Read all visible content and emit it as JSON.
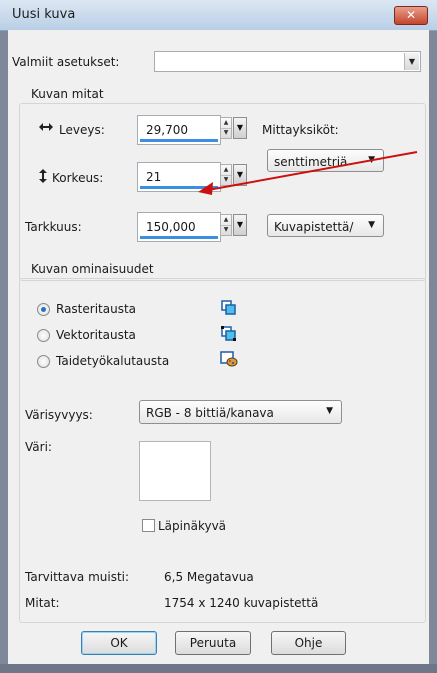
{
  "window": {
    "title": "Uusi kuva",
    "close_label": "✕"
  },
  "presets": {
    "label": "Valmiit asetukset:",
    "value": ""
  },
  "dimensions": {
    "group_label": "Kuvan mitat",
    "width_label": "Leveys:",
    "width_value": "29,700",
    "height_label": "Korkeus:",
    "height_value": "21",
    "resolution_label": "Tarkkuus:",
    "resolution_value": "150,000",
    "units_label": "Mittayksiköt:",
    "units_value": "senttimetriä",
    "resolution_unit_value": "Kuvapistettä/"
  },
  "properties": {
    "group_label": "Kuvan ominaisuudet",
    "options": [
      {
        "label": "Rasteritausta",
        "selected": true,
        "icon": "raster-layer-icon"
      },
      {
        "label": "Vektoritausta",
        "selected": false,
        "icon": "vector-layer-icon"
      },
      {
        "label": "Taidetyökalutausta",
        "selected": false,
        "icon": "art-media-layer-icon"
      }
    ],
    "depth_label": "Värisyvyys:",
    "depth_value": "RGB - 8 bittiä/kanava",
    "color_label": "Väri:",
    "transparent_label": "Läpinäkyvä",
    "transparent_checked": false,
    "memory_label": "Tarvittava muisti:",
    "memory_value": "6,5 Megatavua",
    "size_label": "Mitat:",
    "size_value": "1754 x 1240 kuvapistettä"
  },
  "buttons": {
    "ok": "OK",
    "cancel": "Peruuta",
    "help": "Ohje"
  },
  "colors": {
    "accent_bar": "#3c8fde",
    "annotation_arrow": "#cc1010",
    "swatch": "#ffffff"
  }
}
